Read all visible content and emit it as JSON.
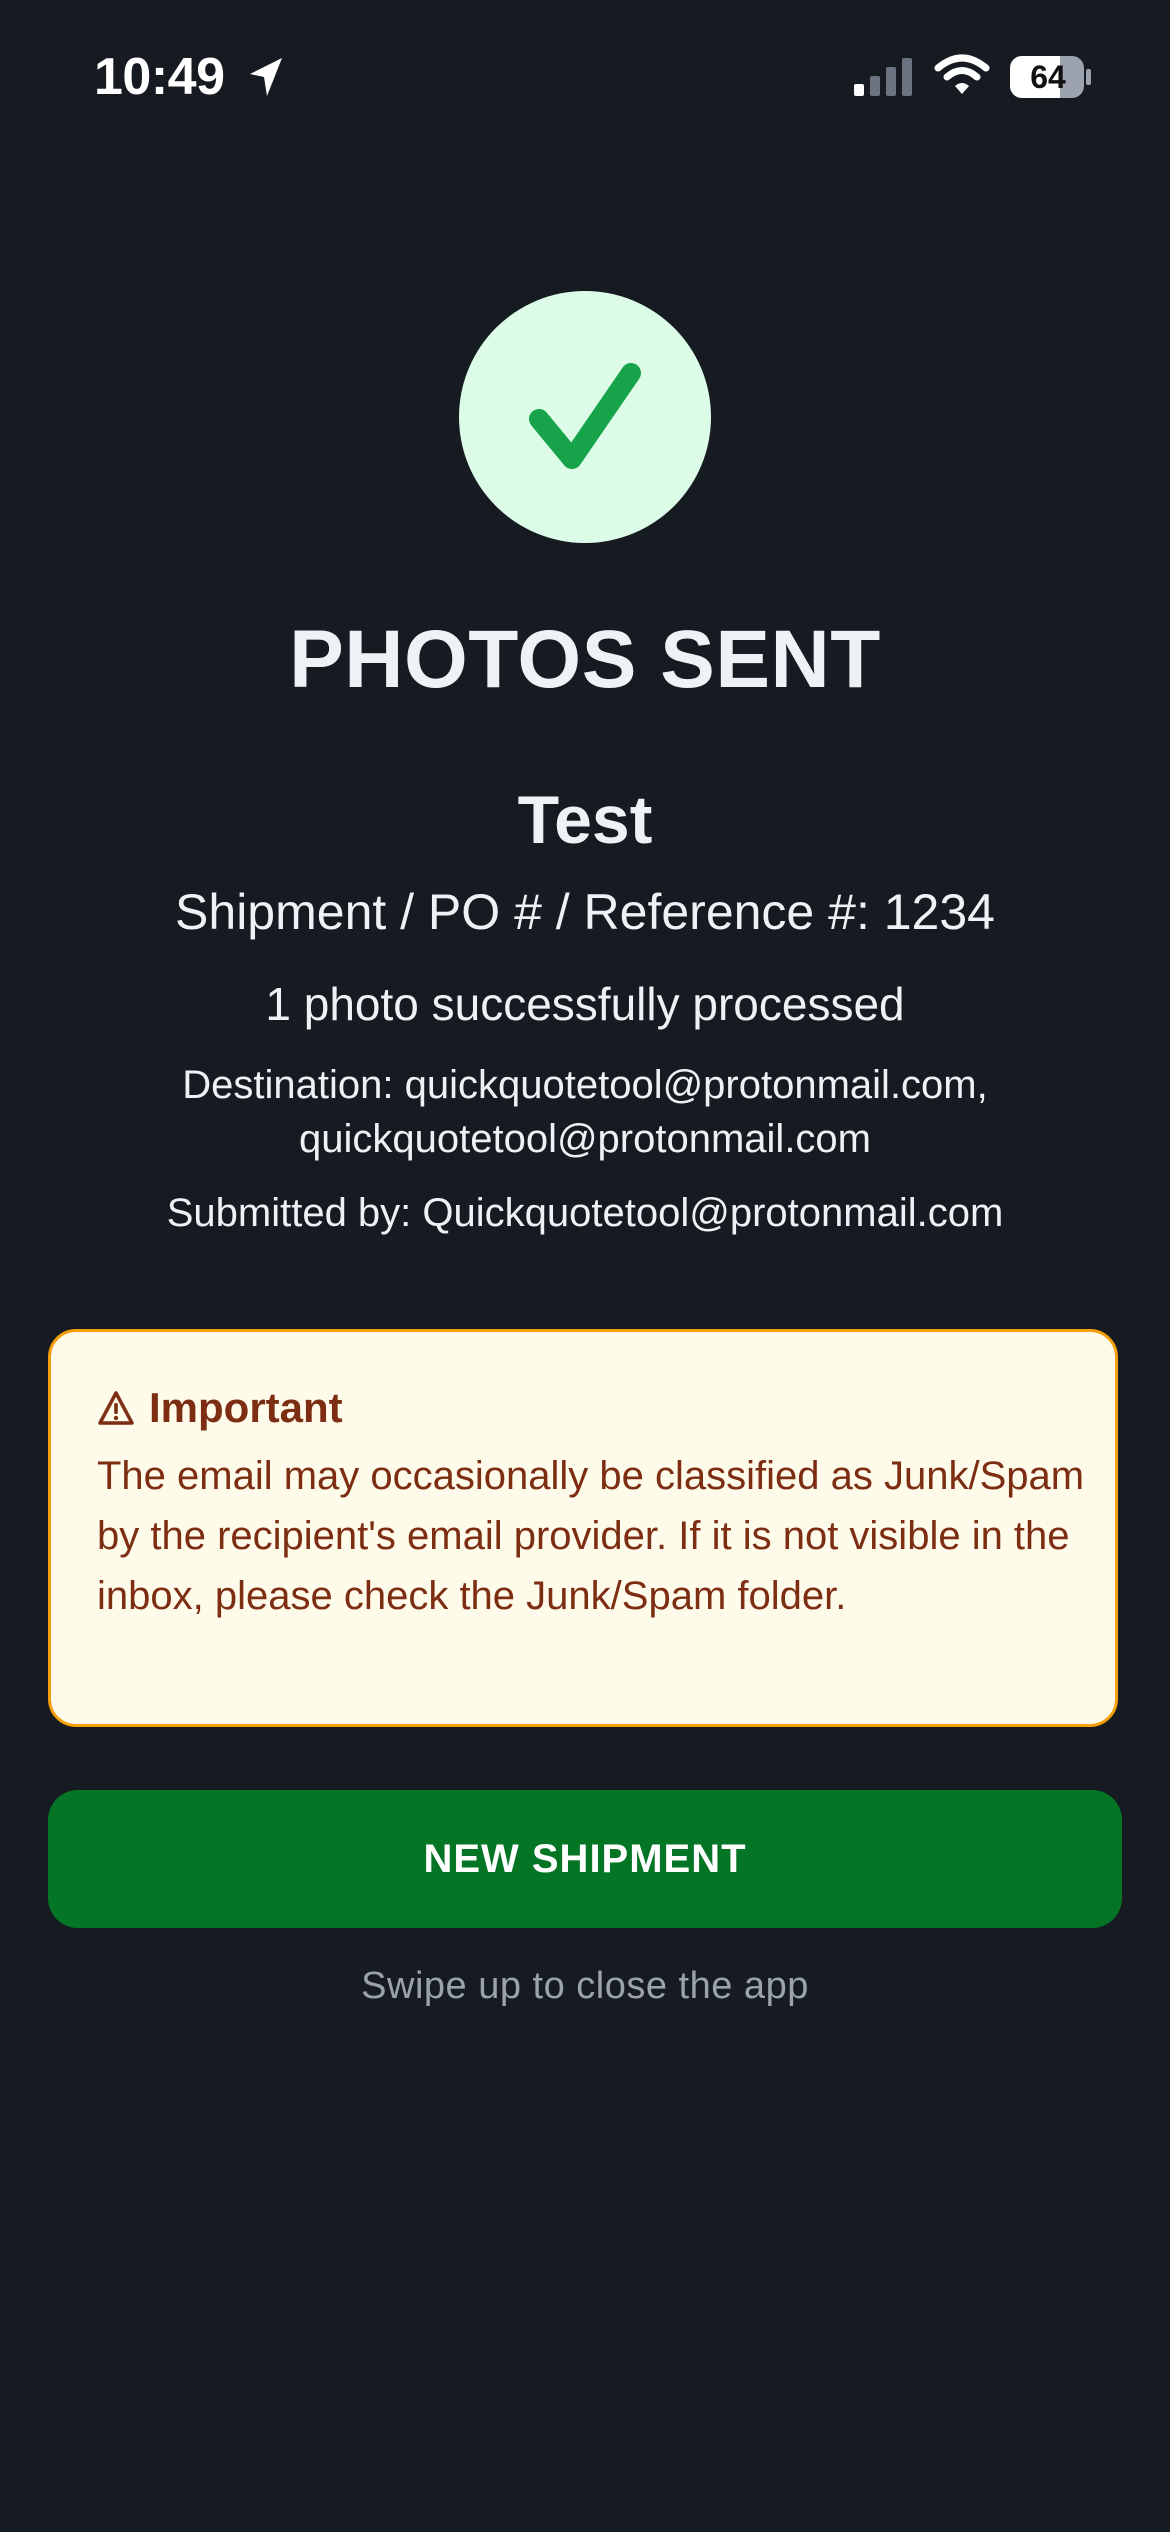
{
  "status_bar": {
    "time": "10:49",
    "battery_level": "64"
  },
  "success": {
    "title": "PHOTOS SENT",
    "customer_name": "Test",
    "reference_line": "Shipment / PO # / Reference #: 1234",
    "processed_line": "1 photo successfully processed",
    "destination_line_1": "Destination: quickquotetool@protonmail.com,",
    "destination_line_2": "quickquotetool@protonmail.com",
    "submitted_line": "Submitted by: Quickquotetool@protonmail.com"
  },
  "warning": {
    "title": "Important",
    "body": "The email may occasionally be classified as Junk/Spam by the recipient's email provider. If it is not visible in the inbox, please check the Junk/Spam folder."
  },
  "actions": {
    "new_shipment_label": "NEW SHIPMENT",
    "footer_hint": "Swipe up to close the app"
  },
  "colors": {
    "background": "#161b22",
    "success_circle": "#dcfce7",
    "check_mark": "#16a34a",
    "warning_background": "#fffbeb",
    "warning_border": "#f59e0b",
    "warning_text": "#7c2d12",
    "button": "#047524"
  },
  "icons": {
    "status_location": "location-arrow-icon",
    "status_signal": "cellular-signal-icon",
    "status_wifi": "wifi-icon",
    "status_battery": "battery-icon",
    "success": "check-icon",
    "warning": "warning-triangle-icon"
  }
}
